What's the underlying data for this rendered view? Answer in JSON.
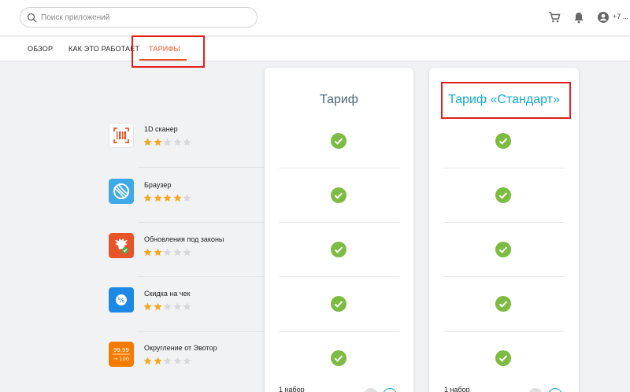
{
  "search": {
    "placeholder": "Поиск приложений"
  },
  "header": {
    "phone": "+7 ..."
  },
  "tabs": [
    {
      "label": "ОБЗОР"
    },
    {
      "label": "КАК ЭТО РАБОТАЕТ"
    },
    {
      "label": "ТАРИФЫ",
      "active": true
    }
  ],
  "apps": [
    {
      "name": "1D сканер",
      "rating": 2,
      "icon": "barcode-scanner-icon"
    },
    {
      "name": "Браузер",
      "rating": 4,
      "icon": "browser-globe-icon"
    },
    {
      "name": "Обновления под законы",
      "rating": 2,
      "icon": "law-updates-eagle-icon"
    },
    {
      "name": "Скидка на чек",
      "rating": 2,
      "icon": "discount-percent-icon"
    },
    {
      "name": "Округление от Эвотор",
      "rating": 2,
      "icon": "rounding-icon",
      "logo_text_top": "99.99",
      "logo_text_bottom": "→ 100"
    }
  ],
  "plans": [
    {
      "title": "Тариф",
      "footer": "1 набор"
    },
    {
      "title": "Тариф «Стандарт»",
      "footer": "1 набор"
    }
  ],
  "colors": {
    "accent": "#e8542a",
    "plan_highlight": "#19a8c7",
    "check_green": "#7dbb42",
    "star_filled": "#f5a623",
    "star_empty": "#d9d9d9",
    "annotation_red": "#e02020"
  }
}
